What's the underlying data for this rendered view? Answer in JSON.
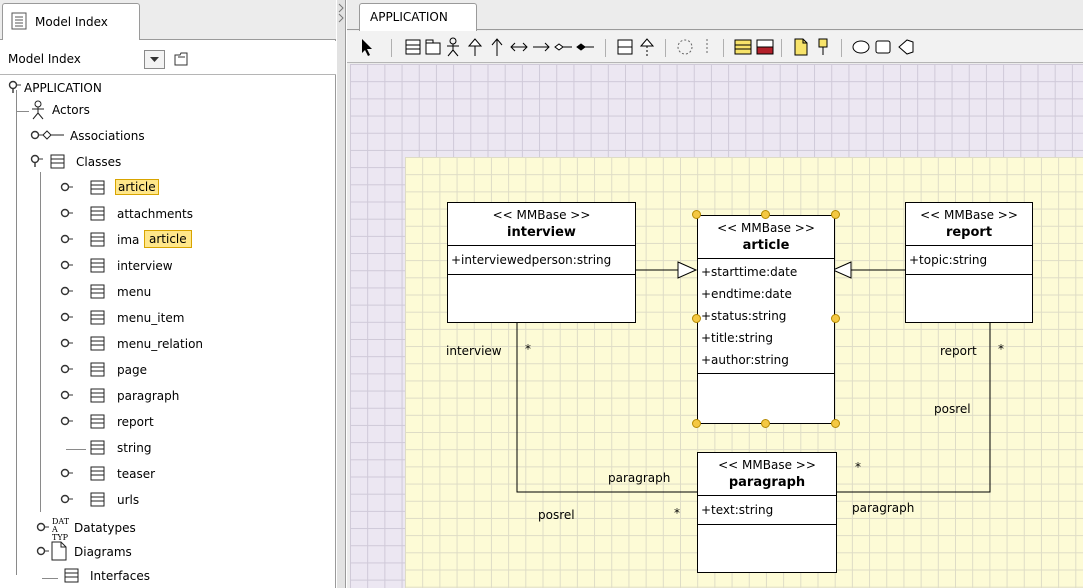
{
  "left": {
    "tab_label": "Model Index",
    "select_label": "Model Index",
    "tree": {
      "root": "APPLICATION",
      "actors": "Actors",
      "associations": "Associations",
      "classes": "Classes",
      "class_items": [
        "article",
        "attachments",
        "ima",
        "interview",
        "menu",
        "menu_item",
        "menu_relation",
        "page",
        "paragraph",
        "report",
        "string",
        "teaser",
        "urls"
      ],
      "tooltip": "article",
      "datatypes": "Datatypes",
      "datatype_icon_text": "DATA TYPE",
      "diagrams": "Diagrams",
      "interfaces": "Interfaces"
    }
  },
  "right": {
    "tab_label": "APPLICATION",
    "toolbar_icons": [
      "pointer-icon",
      "class-icon",
      "package-icon",
      "actor-icon",
      "generalization-icon",
      "dependency-icon",
      "association-icon",
      "directed-association-icon",
      "aggregation-icon",
      "composition-icon",
      "interface-icon",
      "realization-icon",
      "note-icon",
      "anchor-icon",
      "color-fill-icon",
      "color-fill-red-icon",
      "new-diagram-icon",
      "pin-icon",
      "ellipse-icon",
      "rectangle-icon",
      "polygon-icon"
    ]
  },
  "diagram": {
    "stereotype": "<< MMBase >>",
    "classes": {
      "interview": {
        "name": "interview",
        "attributes": [
          "+interviewedperson:string"
        ]
      },
      "article": {
        "name": "article",
        "attributes": [
          "+starttime:date",
          "+endtime:date",
          "+status:string",
          "+title:string",
          "+author:string"
        ]
      },
      "report": {
        "name": "report",
        "attributes": [
          "+topic:string"
        ]
      },
      "paragraph": {
        "name": "paragraph",
        "attributes": [
          "+text:string"
        ]
      }
    },
    "labels": {
      "interview_role": "interview",
      "interview_mult": "*",
      "report_role": "report",
      "report_mult": "*",
      "posrel_right": "posrel",
      "paragraph_left": "paragraph",
      "paragraph_right": "paragraph",
      "posrel_left": "posrel",
      "mult_left_bottom": "*",
      "mult_right_bottom": "*"
    }
  },
  "colors": {
    "canvas_bg": "#ece7f2",
    "package_bg": "#fdfbd6",
    "highlight": "#ffe78a",
    "handle": "#f4c842"
  }
}
